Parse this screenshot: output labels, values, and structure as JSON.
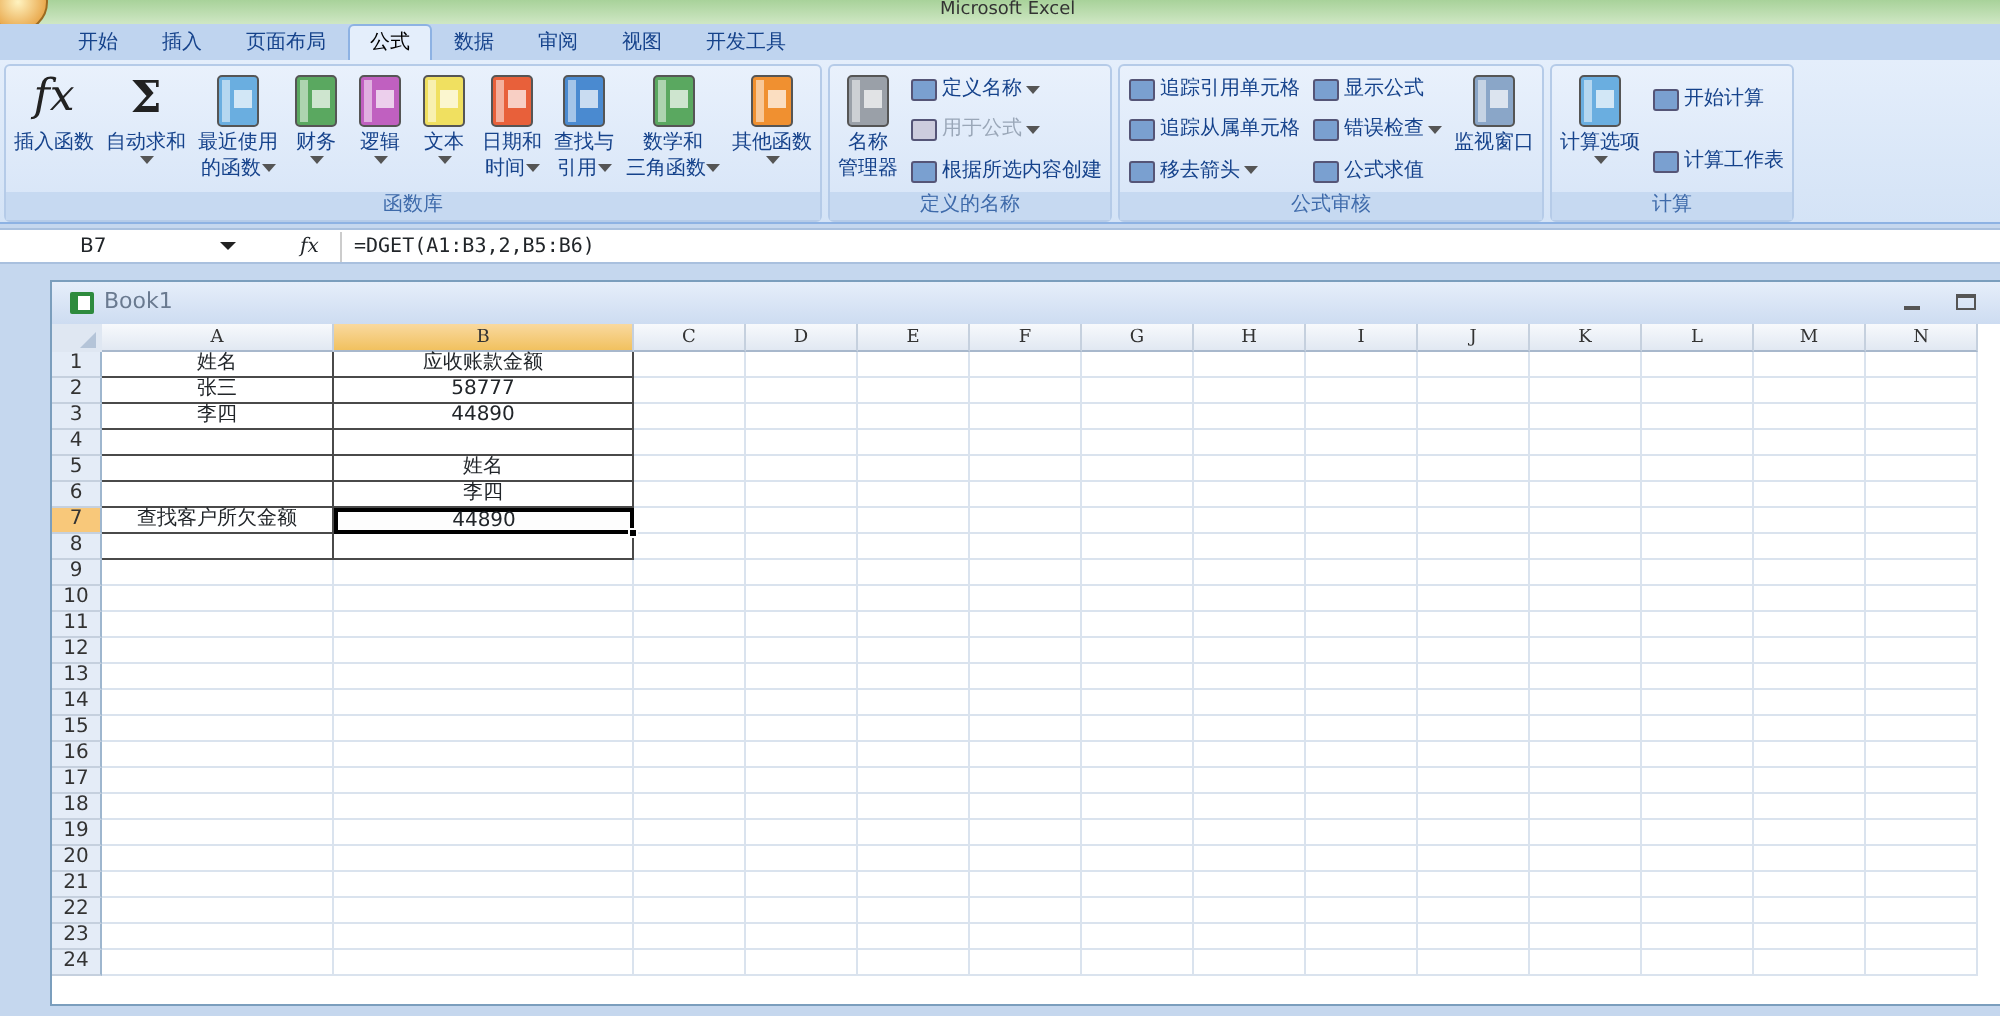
{
  "window": {
    "title": "Microsoft Excel"
  },
  "ribbon_tabs": [
    {
      "label": "开始",
      "selected": false
    },
    {
      "label": "插入",
      "selected": false
    },
    {
      "label": "页面布局",
      "selected": false
    },
    {
      "label": "公式",
      "selected": true
    },
    {
      "label": "数据",
      "selected": false
    },
    {
      "label": "审阅",
      "selected": false
    },
    {
      "label": "视图",
      "selected": false
    },
    {
      "label": "开发工具",
      "selected": false
    }
  ],
  "ribbon_groups": [
    {
      "label": "函数库",
      "columns": [
        {
          "kind": "large",
          "glyph": "fx",
          "lines": [
            "插入函数"
          ],
          "dropdown": false
        },
        {
          "kind": "large",
          "glyph": "Σ",
          "lines": [
            "自动求和"
          ],
          "dropdown": true
        },
        {
          "kind": "large",
          "lines": [
            "最近使用",
            "的函数"
          ],
          "dropdown": true
        },
        {
          "kind": "large",
          "lines": [
            "财务"
          ],
          "dropdown": true
        },
        {
          "kind": "large",
          "lines": [
            "逻辑"
          ],
          "dropdown": true
        },
        {
          "kind": "large",
          "lines": [
            "文本"
          ],
          "dropdown": true
        },
        {
          "kind": "large",
          "lines": [
            "日期和",
            "时间"
          ],
          "dropdown": true
        },
        {
          "kind": "large",
          "lines": [
            "查找与",
            "引用"
          ],
          "dropdown": true
        },
        {
          "kind": "large",
          "lines": [
            "数学和",
            "三角函数"
          ],
          "dropdown": true
        },
        {
          "kind": "large",
          "lines": [
            "其他函数"
          ],
          "dropdown": true
        }
      ]
    },
    {
      "label": "定义的名称",
      "columns": [
        {
          "kind": "large",
          "lines": [
            "名称",
            "管理器"
          ],
          "dropdown": false
        },
        {
          "kind": "stack",
          "items": [
            {
              "label": "定义名称",
              "dropdown": true,
              "disabled": false
            },
            {
              "label": "用于公式",
              "dropdown": true,
              "disabled": true
            },
            {
              "label": "根据所选内容创建",
              "dropdown": false,
              "disabled": false
            }
          ]
        }
      ]
    },
    {
      "label": "公式审核",
      "columns": [
        {
          "kind": "stack",
          "items": [
            {
              "label": "追踪引用单元格",
              "dropdown": false,
              "disabled": false
            },
            {
              "label": "追踪从属单元格",
              "dropdown": false,
              "disabled": false
            },
            {
              "label": "移去箭头",
              "dropdown": true,
              "disabled": false
            }
          ]
        },
        {
          "kind": "stack",
          "items": [
            {
              "label": "显示公式",
              "dropdown": false,
              "disabled": false
            },
            {
              "label": "错误检查",
              "dropdown": true,
              "disabled": false
            },
            {
              "label": "公式求值",
              "dropdown": false,
              "disabled": false
            }
          ]
        },
        {
          "kind": "large",
          "lines": [
            "监视窗口"
          ],
          "dropdown": false
        }
      ]
    },
    {
      "label": "计算",
      "columns": [
        {
          "kind": "large",
          "lines": [
            "计算选项"
          ],
          "dropdown": true
        },
        {
          "kind": "stack",
          "items": [
            {
              "label": "开始计算",
              "dropdown": false,
              "disabled": false
            },
            {
              "label": "计算工作表",
              "dropdown": false,
              "disabled": false
            }
          ]
        }
      ]
    }
  ],
  "formula_bar": {
    "name_box": "B7",
    "fx_icon": "fx",
    "formula": "=DGET(A1:B3,2,B5:B6)"
  },
  "workbook": {
    "title": "Book1",
    "columns": [
      {
        "label": "A",
        "selected": false
      },
      {
        "label": "B",
        "selected": true
      },
      {
        "label": "C",
        "selected": false
      },
      {
        "label": "D",
        "selected": false
      },
      {
        "label": "E",
        "selected": false
      },
      {
        "label": "F",
        "selected": false
      },
      {
        "label": "G",
        "selected": false
      },
      {
        "label": "H",
        "selected": false
      },
      {
        "label": "I",
        "selected": false
      },
      {
        "label": "J",
        "selected": false
      },
      {
        "label": "K",
        "selected": false
      },
      {
        "label": "L",
        "selected": false
      },
      {
        "label": "M",
        "selected": false
      },
      {
        "label": "N",
        "selected": false
      }
    ],
    "rows": [
      {
        "header": "1",
        "selected": false,
        "bordered": true,
        "cells": [
          {
            "text": "姓名",
            "active": false
          },
          {
            "text": "应收账款金额",
            "active": false
          }
        ]
      },
      {
        "header": "2",
        "selected": false,
        "bordered": true,
        "cells": [
          {
            "text": "张三",
            "active": false
          },
          {
            "text": "58777",
            "active": false
          }
        ]
      },
      {
        "header": "3",
        "selected": false,
        "bordered": true,
        "cells": [
          {
            "text": "李四",
            "active": false
          },
          {
            "text": "44890",
            "active": false
          }
        ]
      },
      {
        "header": "4",
        "selected": false,
        "bordered": true,
        "cells": []
      },
      {
        "header": "5",
        "selected": false,
        "bordered": true,
        "cells": [
          null,
          {
            "text": "姓名",
            "active": false
          }
        ]
      },
      {
        "header": "6",
        "selected": false,
        "bordered": true,
        "cells": [
          null,
          {
            "text": "李四",
            "active": false
          }
        ]
      },
      {
        "header": "7",
        "selected": true,
        "bordered": true,
        "cells": [
          {
            "text": "查找客户所欠金额",
            "active": false
          },
          {
            "text": "44890",
            "active": true
          }
        ]
      },
      {
        "header": "8",
        "selected": false,
        "bordered": true,
        "cells": []
      },
      {
        "header": "9",
        "selected": false,
        "bordered": false,
        "cells": []
      },
      {
        "header": "10",
        "selected": false,
        "bordered": false,
        "cells": []
      },
      {
        "header": "11",
        "selected": false,
        "bordered": false,
        "cells": []
      },
      {
        "header": "12",
        "selected": false,
        "bordered": false,
        "cells": []
      },
      {
        "header": "13",
        "selected": false,
        "bordered": false,
        "cells": []
      },
      {
        "header": "14",
        "selected": false,
        "bordered": false,
        "cells": []
      },
      {
        "header": "15",
        "selected": false,
        "bordered": false,
        "cells": []
      },
      {
        "header": "16",
        "selected": false,
        "bordered": false,
        "cells": []
      },
      {
        "header": "17",
        "selected": false,
        "bordered": false,
        "cells": []
      },
      {
        "header": "18",
        "selected": false,
        "bordered": false,
        "cells": []
      },
      {
        "header": "19",
        "selected": false,
        "bordered": false,
        "cells": []
      },
      {
        "header": "20",
        "selected": false,
        "bordered": false,
        "cells": []
      },
      {
        "header": "21",
        "selected": false,
        "bordered": false,
        "cells": []
      },
      {
        "header": "22",
        "selected": false,
        "bordered": false,
        "cells": []
      },
      {
        "header": "23",
        "selected": false,
        "bordered": false,
        "cells": []
      },
      {
        "header": "24",
        "selected": false,
        "bordered": false,
        "cells": []
      }
    ]
  }
}
